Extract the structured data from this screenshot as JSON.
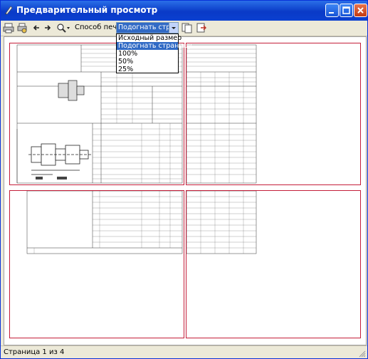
{
  "window": {
    "title": "Предварительный просмотр"
  },
  "toolbar": {
    "print_mode_label": "Способ печати",
    "print_mode_value": "Подогнать страницу"
  },
  "dropdown": {
    "options": [
      "Исходный размер",
      "Подогнать страницу",
      "100%",
      "50%",
      "25%"
    ],
    "selected_index": 1
  },
  "statusbar": {
    "text": "Страница 1 из 4"
  },
  "preview": {
    "pages_total": 4,
    "current_page": 1
  },
  "colors": {
    "titlebar": "#0a3ac7",
    "page_border": "#c41e3a",
    "selection": "#316ac5"
  }
}
